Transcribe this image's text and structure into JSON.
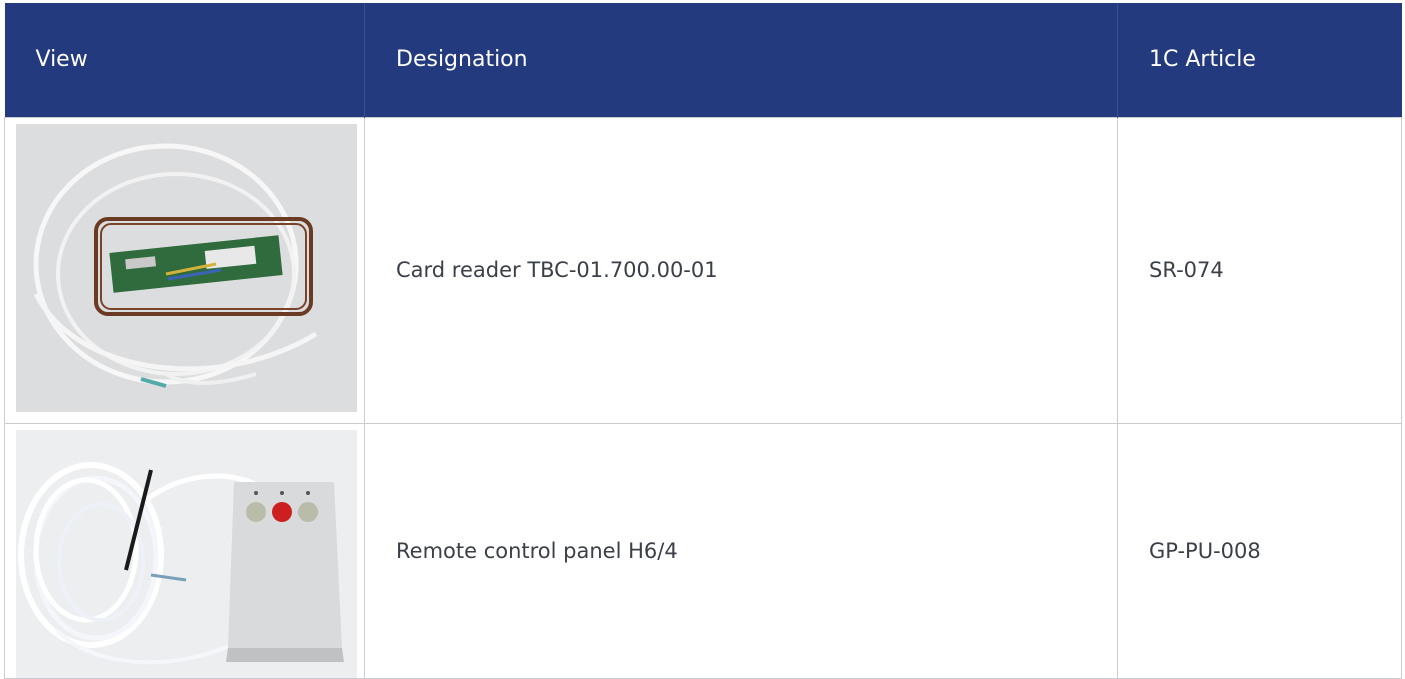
{
  "table": {
    "headers": [
      "View",
      "Designation",
      "1C Article"
    ],
    "rows": [
      {
        "image": "card-reader-photo",
        "designation": "Card reader TBC-01.700.00-01",
        "article": "SR-074"
      },
      {
        "image": "remote-control-panel-photo",
        "designation": "Remote control panel H6/4",
        "article": "GP-PU-008"
      }
    ]
  },
  "colors": {
    "header_bg": "#233a7e",
    "header_text": "#ffffff",
    "border": "#c9ccd1",
    "body_text": "#3b3f47"
  }
}
